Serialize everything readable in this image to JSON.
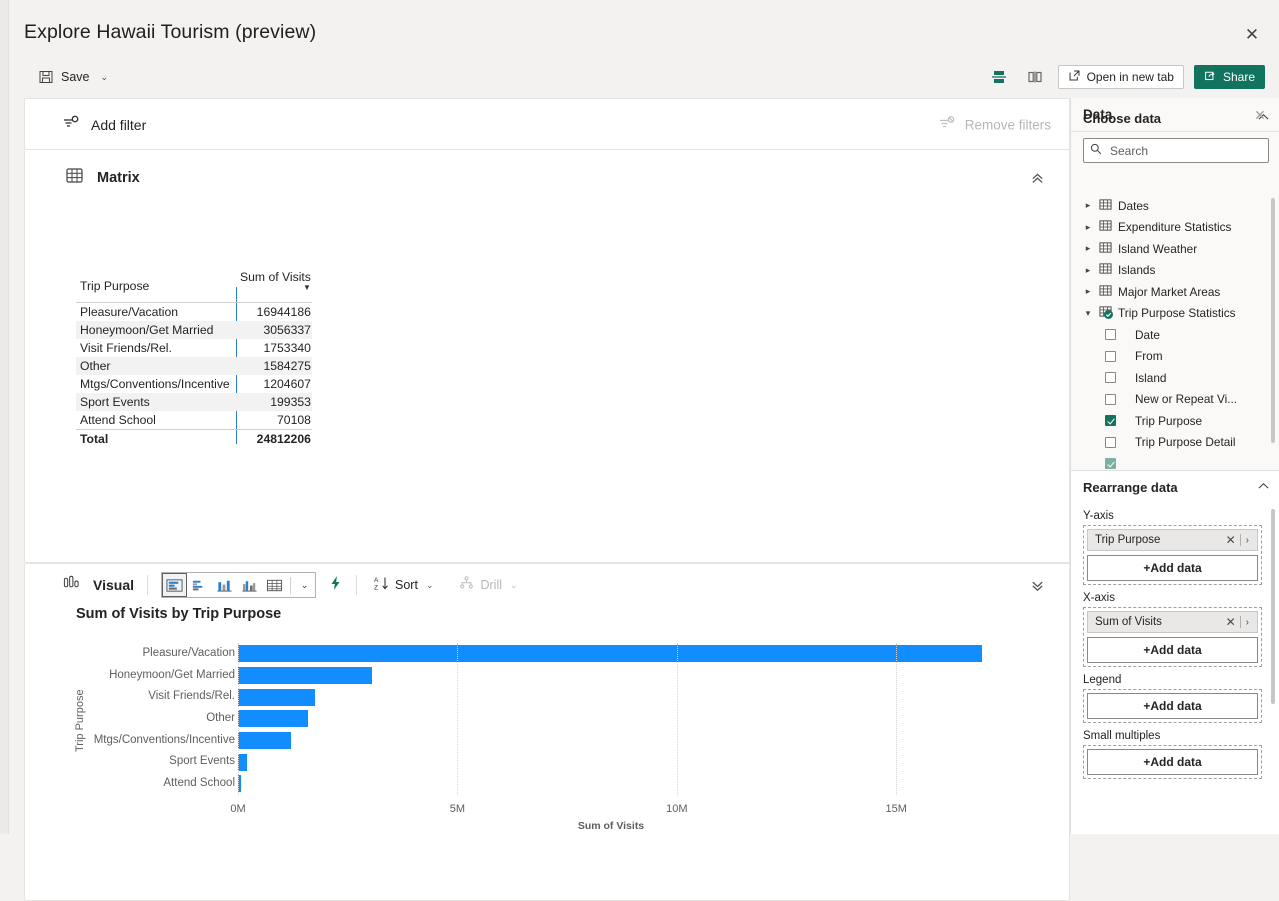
{
  "window": {
    "title": "Explore Hawaii Tourism (preview)",
    "close_icon": "close-icon"
  },
  "commandbar": {
    "save_label": "Save",
    "save_icon": "save-icon",
    "save_caret": "⌄",
    "view_horizontal_icon": "split-horizontal-icon",
    "view_vertical_icon": "split-vertical-icon",
    "open_new_tab_label": "Open in new tab",
    "open_new_tab_icon": "open-external-icon",
    "share_label": "Share",
    "share_icon": "share-icon",
    "accent_color": "#12735e"
  },
  "filter_bar": {
    "add_filter_label": "Add filter",
    "add_filter_icon": "filter-add-icon",
    "remove_filters_label": "Remove filters",
    "remove_filters_icon": "filter-remove-icon",
    "remove_filters_disabled": true
  },
  "matrix": {
    "title": "Matrix",
    "icon": "table-grid-icon",
    "collapse_icon": "double-chevron-up-icon",
    "columns": [
      "Trip Purpose",
      "Sum of Visits"
    ],
    "sort_indicator": "▼",
    "rows": [
      {
        "purpose": "Pleasure/Vacation",
        "visits": "16944186"
      },
      {
        "purpose": "Honeymoon/Get Married",
        "visits": "3056337"
      },
      {
        "purpose": "Visit Friends/Rel.",
        "visits": "1753340"
      },
      {
        "purpose": "Other",
        "visits": "1584275"
      },
      {
        "purpose": "Mtgs/Conventions/Incentive",
        "visits": "1204607"
      },
      {
        "purpose": "Sport Events",
        "visits": "199353"
      },
      {
        "purpose": "Attend School",
        "visits": "70108"
      }
    ],
    "total": {
      "label": "Total",
      "value": "24812206"
    }
  },
  "visual": {
    "title": "Visual",
    "icon": "bar-chart-small-icon",
    "collapse_icon": "double-chevron-down-icon",
    "chart_types": [
      {
        "name": "stacked-bar-chart-icon",
        "selected": true
      },
      {
        "name": "clustered-bar-chart-icon",
        "selected": false
      },
      {
        "name": "stacked-column-chart-icon",
        "selected": false
      },
      {
        "name": "clustered-column-chart-icon",
        "selected": false
      },
      {
        "name": "table-chart-icon",
        "selected": false
      }
    ],
    "chart_type_caret": "⌄",
    "quick_insights_icon": "lightning-bolt-icon",
    "sort_label": "Sort",
    "sort_icon": "sort-az-icon",
    "sort_caret": "⌄",
    "drill_label": "Drill",
    "drill_icon": "drill-icon",
    "drill_caret": "⌄",
    "drill_disabled": true
  },
  "chart_data": {
    "type": "bar",
    "title": "Sum of Visits by Trip Purpose",
    "xlabel": "Sum of Visits",
    "ylabel": "Trip Purpose",
    "orientation": "horizontal",
    "categories": [
      "Pleasure/Vacation",
      "Honeymoon/Get Married",
      "Visit Friends/Rel.",
      "Other",
      "Mtgs/Conventions/Incentive",
      "Sport Events",
      "Attend School"
    ],
    "values": [
      16944186,
      3056337,
      1753340,
      1584275,
      1204607,
      199353,
      70108
    ],
    "xlim": [
      0,
      17000000
    ],
    "xticks": [
      0,
      5000000,
      10000000,
      15000000
    ],
    "xtick_labels": [
      "0M",
      "5M",
      "10M",
      "15M"
    ],
    "bar_color": "#118dff",
    "grid": true,
    "legend": null
  },
  "data_panel": {
    "title": "Data",
    "close_icon": "close-icon",
    "choose_data": {
      "title": "Choose data",
      "chevron": "⌃",
      "search_placeholder": "Search",
      "search_value": "",
      "search_icon": "search-icon"
    },
    "tables": [
      {
        "label": "Dates",
        "expanded": false,
        "icon": "table-icon"
      },
      {
        "label": "Expenditure Statistics",
        "expanded": false,
        "icon": "table-icon"
      },
      {
        "label": "Island Weather",
        "expanded": false,
        "icon": "table-icon"
      },
      {
        "label": "Islands",
        "expanded": false,
        "icon": "table-icon"
      },
      {
        "label": "Major Market Areas",
        "expanded": false,
        "icon": "table-icon"
      },
      {
        "label": "Trip Purpose Statistics",
        "expanded": true,
        "icon": "table-selected-icon"
      }
    ],
    "fields": [
      {
        "label": "Date",
        "checked": false
      },
      {
        "label": "From",
        "checked": false
      },
      {
        "label": "Island",
        "checked": false
      },
      {
        "label": "New or Repeat Vi...",
        "checked": false
      },
      {
        "label": "Trip Purpose",
        "checked": true
      },
      {
        "label": "Trip Purpose Detail",
        "checked": false
      }
    ],
    "rearrange": {
      "title": "Rearrange data",
      "chevron": "⌃",
      "wells": [
        {
          "label": "Y-axis",
          "pills": [
            {
              "name": "Trip Purpose",
              "remove_icon": "close-icon",
              "expand_icon": "chevron-right-icon"
            }
          ],
          "add_label": "+Add data"
        },
        {
          "label": "X-axis",
          "pills": [
            {
              "name": "Sum of Visits",
              "remove_icon": "close-icon",
              "expand_icon": "chevron-right-icon"
            }
          ],
          "add_label": "+Add data"
        },
        {
          "label": "Legend",
          "pills": [],
          "add_label": "+Add data"
        },
        {
          "label": "Small multiples",
          "pills": [],
          "add_label": "+Add data"
        }
      ]
    }
  }
}
